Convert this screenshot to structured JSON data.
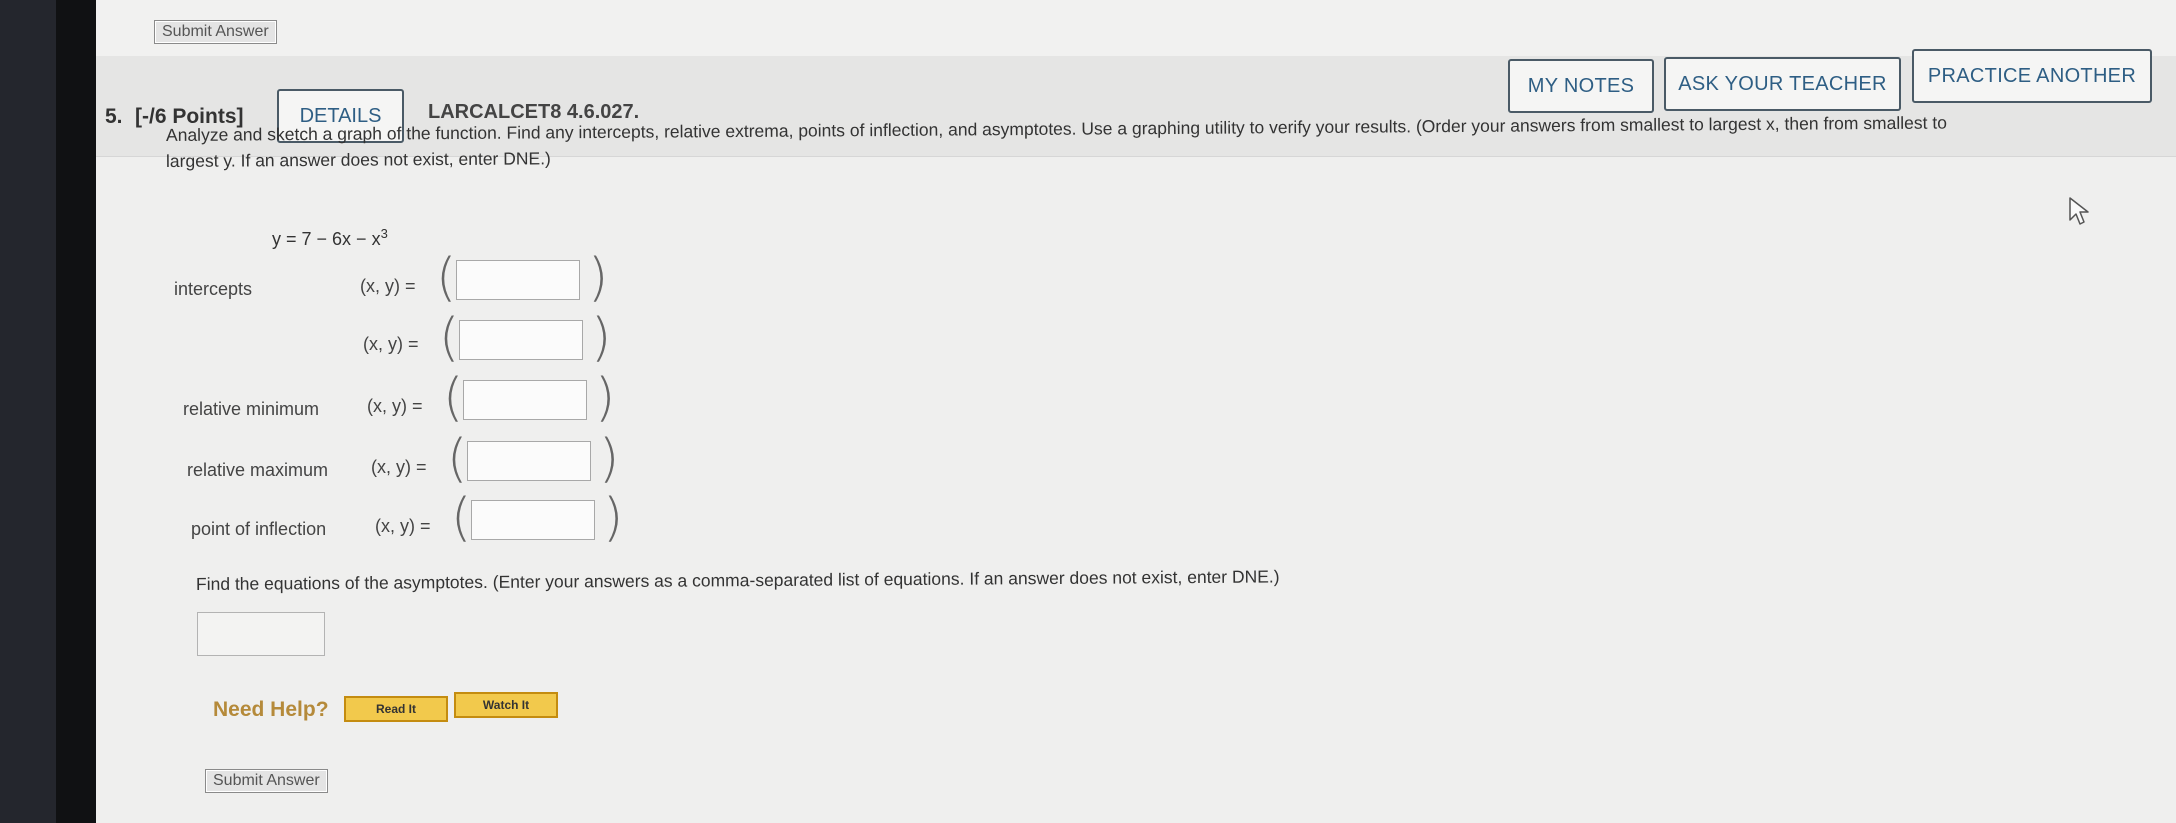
{
  "top_submit_label": "Submit Answer",
  "question": {
    "number": "5.",
    "points": "[-/6 Points]",
    "details_label": "DETAILS",
    "code": "LARCALCET8 4.6.027."
  },
  "header_buttons": {
    "my_notes": "MY NOTES",
    "ask_teacher": "ASK YOUR TEACHER",
    "practice_another": "PRACTICE ANOTHER"
  },
  "instructions_line1": "Analyze and sketch a graph of the function. Find any intercepts, relative extrema, points of inflection, and asymptotes. Use a graphing utility to verify your results. (Order your answers from smallest to largest x, then from smallest to",
  "instructions_line2": "largest y. If an answer does not exist, enter DNE.)",
  "equation": {
    "lhs": "y = 7 − 6x − x",
    "exponent": "3"
  },
  "rows": [
    {
      "label": "intercepts",
      "xy": "(x, y) ="
    },
    {
      "label": "",
      "xy": "(x, y) ="
    },
    {
      "label": "relative minimum",
      "xy": "(x, y) ="
    },
    {
      "label": "relative maximum",
      "xy": "(x, y) ="
    },
    {
      "label": "point of inflection",
      "xy": "(x, y) ="
    }
  ],
  "asymptote_instructions": "Find the equations of the asymptotes. (Enter your answers as a comma-separated list of equations. If an answer does not exist, enter DNE.)",
  "need_help": {
    "label": "Need Help?",
    "read_it": "Read It",
    "watch_it": "Watch It"
  },
  "bottom_submit_label": "Submit Answer",
  "colors": {
    "link_blue": "#2e5e84",
    "help_gold": "#b58a3a",
    "help_button": "#f2c94c"
  },
  "icons": [
    "mouse-cursor-icon"
  ]
}
